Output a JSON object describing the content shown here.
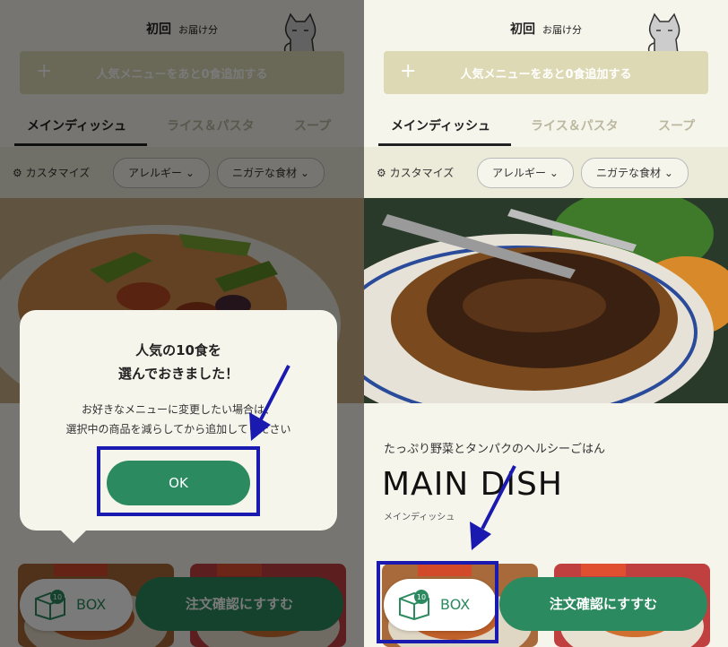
{
  "header": {
    "title": "初回",
    "subtitle": "お届け分"
  },
  "add_bar": {
    "plus": "+",
    "label": "人気メニューをあと0食追加する"
  },
  "tabs": [
    {
      "label": "メインディッシュ"
    },
    {
      "label": "ライス＆パスタ"
    },
    {
      "label": "スープ"
    }
  ],
  "filters": {
    "customize": "カスタマイズ",
    "allergy": "アレルギー",
    "dislike": "ニガテな食材"
  },
  "section": {
    "subtitle": "たっぷり野菜とタンパクのヘルシーごはん",
    "title": "MAIN DISH",
    "title_ja": "メインディッシュ"
  },
  "footer": {
    "box_label": "BOX",
    "box_count": "10",
    "order_label": "注文確認にすすむ"
  },
  "dialog": {
    "title_line1": "人気の10食を",
    "title_line2": "選んでおきました！",
    "body_line1": "お好きなメニューに変更したい場合は、",
    "body_line2": "選択中の商品を減らしてから追加してください",
    "ok_label": "OK"
  },
  "colors": {
    "brand_green": "#2b8a5f",
    "add_bar": "#ddd9b4",
    "background": "#f6f5ec",
    "highlight": "#1a1ab0"
  }
}
